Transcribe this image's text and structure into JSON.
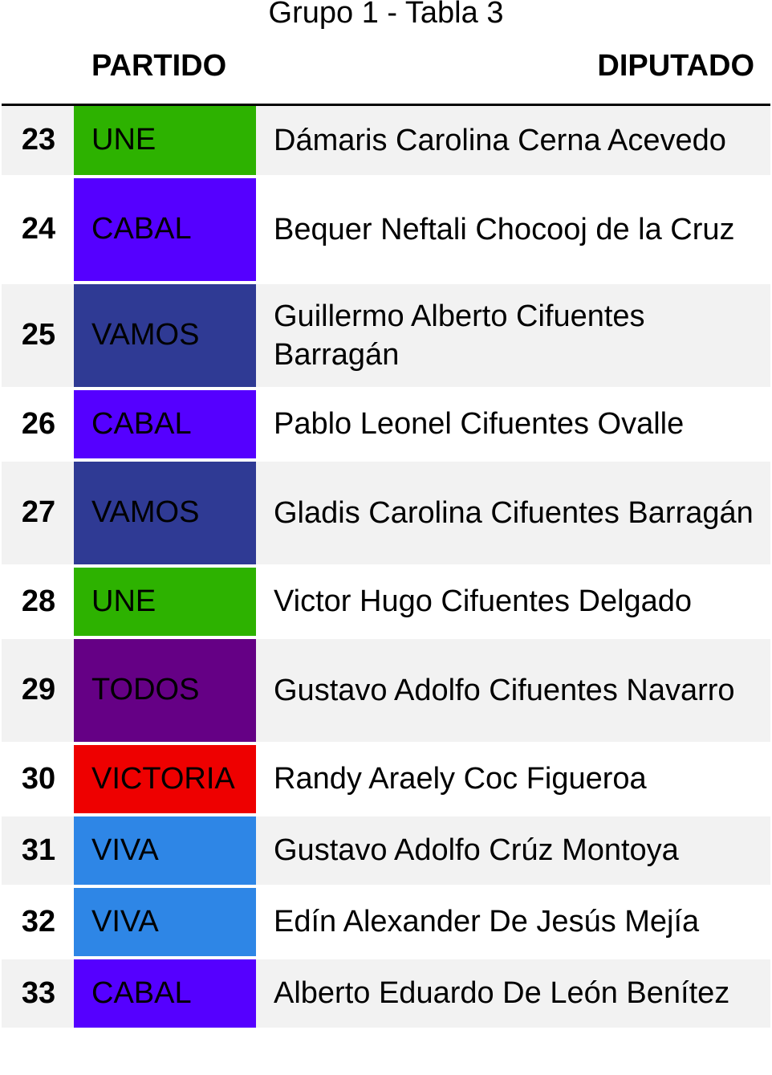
{
  "title": "Grupo 1 - Tabla 3",
  "headers": {
    "party": "PARTIDO",
    "name": "DIPUTADO"
  },
  "party_colors": {
    "UNE": "#2db200",
    "CABAL": "#5500ff",
    "VAMOS": "#2f3a94",
    "TODOS": "#650085",
    "VICTORIA": "#ee0000",
    "VIVA": "#2e86e6"
  },
  "rows": [
    {
      "num": "23",
      "party": "UNE",
      "name": "Dámaris Carolina Cerna Acevedo"
    },
    {
      "num": "24",
      "party": "CABAL",
      "name": "Bequer Neftali Chocooj de la Cruz"
    },
    {
      "num": "25",
      "party": "VAMOS",
      "name": "Guillermo Alberto Cifuentes Barragán"
    },
    {
      "num": "26",
      "party": "CABAL",
      "name": "Pablo Leonel Cifuentes Ovalle"
    },
    {
      "num": "27",
      "party": "VAMOS",
      "name": "Gladis Carolina Cifuentes Barragán"
    },
    {
      "num": "28",
      "party": "UNE",
      "name": "Victor Hugo Cifuentes Delgado"
    },
    {
      "num": "29",
      "party": "TODOS",
      "name": "Gustavo Adolfo Cifuentes Navarro"
    },
    {
      "num": "30",
      "party": "VICTORIA",
      "name": "Randy Araely Coc Figueroa"
    },
    {
      "num": "31",
      "party": "VIVA",
      "name": "Gustavo Adolfo Crúz Montoya"
    },
    {
      "num": "32",
      "party": "VIVA",
      "name": "Edín Alexander De Jesús Mejía"
    },
    {
      "num": "33",
      "party": "CABAL",
      "name": "Alberto Eduardo De León Benítez"
    }
  ]
}
